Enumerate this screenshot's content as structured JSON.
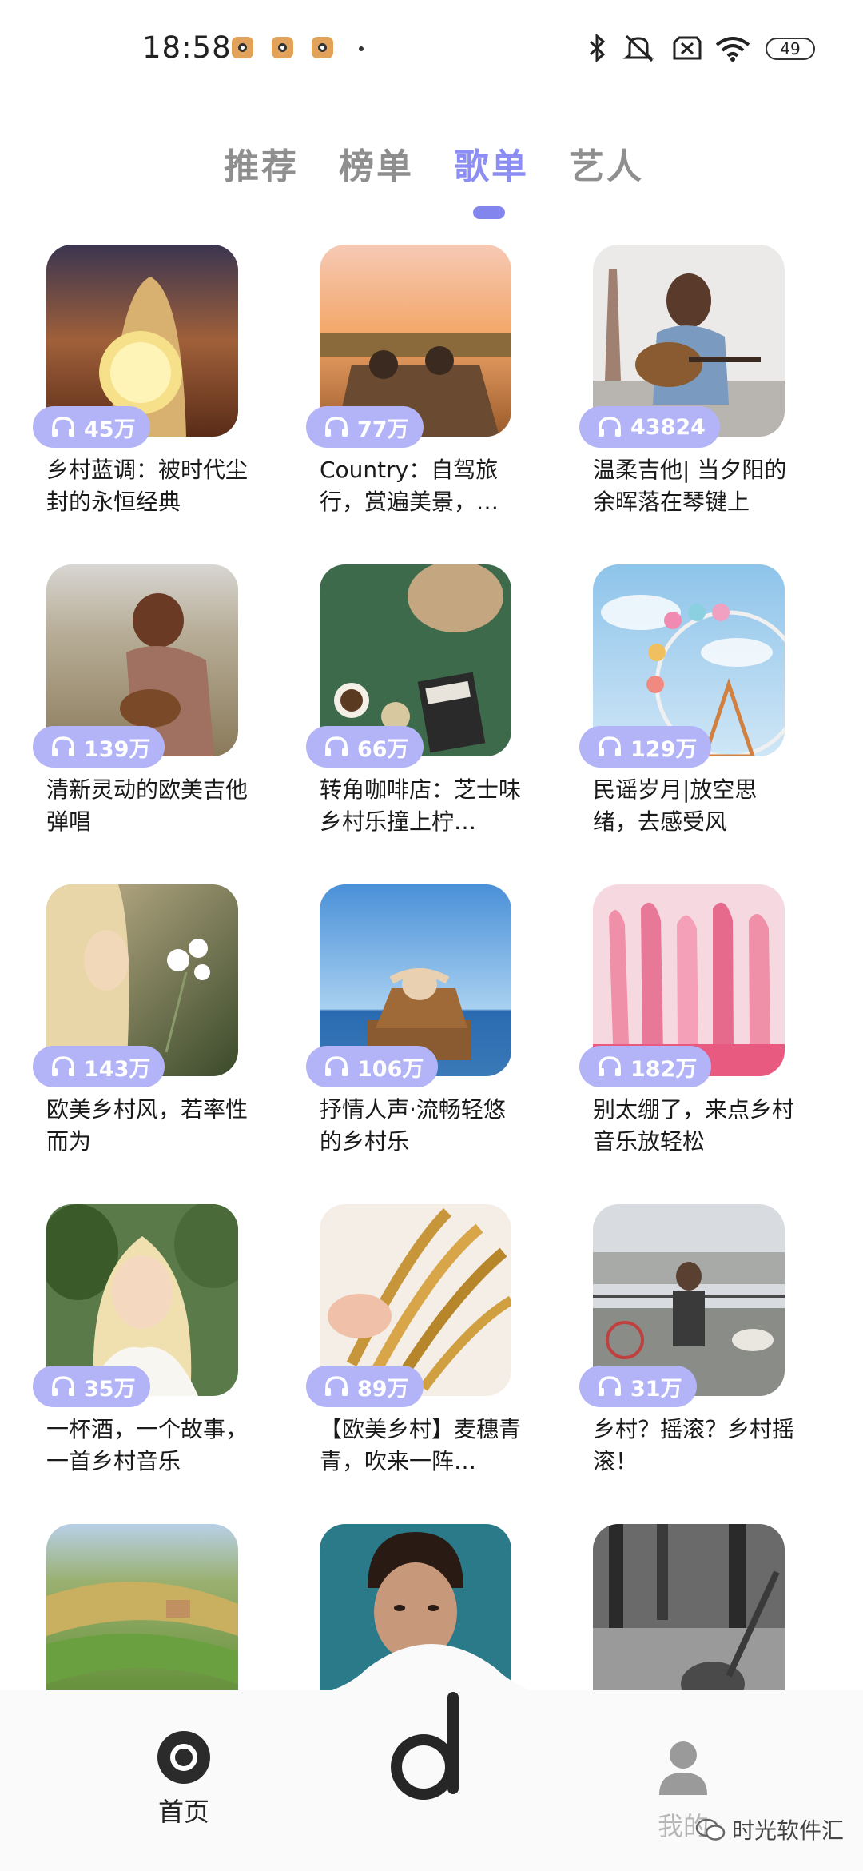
{
  "status_bar": {
    "time": "18:58",
    "battery": "49",
    "icons": [
      "app-notification-icon",
      "app-notification-icon",
      "app-notification-icon",
      "bluetooth-icon",
      "mute-icon",
      "no-sim-icon",
      "wifi-icon",
      "battery-icon"
    ]
  },
  "tabs": [
    {
      "label": "推荐",
      "active": false
    },
    {
      "label": "榜单",
      "active": false
    },
    {
      "label": "歌单",
      "active": true
    },
    {
      "label": "艺人",
      "active": false
    }
  ],
  "accent_color": "#8c8ef4",
  "playlists": [
    {
      "plays": "45万",
      "title": "乡村蓝调：被时代尘封的永恒经典"
    },
    {
      "plays": "77万",
      "title": "Country：自驾旅行，赏遍美景，…"
    },
    {
      "plays": "43824",
      "title": "温柔吉他| 当夕阳的余晖落在琴键上"
    },
    {
      "plays": "139万",
      "title": "清新灵动的欧美吉他弹唱"
    },
    {
      "plays": "66万",
      "title": "转角咖啡店：芝士味乡村乐撞上柠…"
    },
    {
      "plays": "129万",
      "title": "民谣岁月|放空思绪，去感受风"
    },
    {
      "plays": "143万",
      "title": "欧美乡村风，若率性而为"
    },
    {
      "plays": "106万",
      "title": "抒情人声·流畅轻悠的乡村乐"
    },
    {
      "plays": "182万",
      "title": "别太绷了，来点乡村音乐放轻松"
    },
    {
      "plays": "35万",
      "title": "一杯酒，一个故事，一首乡村音乐"
    },
    {
      "plays": "89万",
      "title": "【欧美乡村】麦穗青青，吹来一阵…"
    },
    {
      "plays": "31万",
      "title": "乡村？摇滚？乡村摇滚！"
    },
    {
      "plays": "",
      "title": ""
    },
    {
      "plays": "",
      "title": ""
    },
    {
      "plays": "",
      "title": ""
    }
  ],
  "bottom_nav": {
    "home_label": "首页",
    "me_label": "我的",
    "watermark": "时光软件汇"
  }
}
